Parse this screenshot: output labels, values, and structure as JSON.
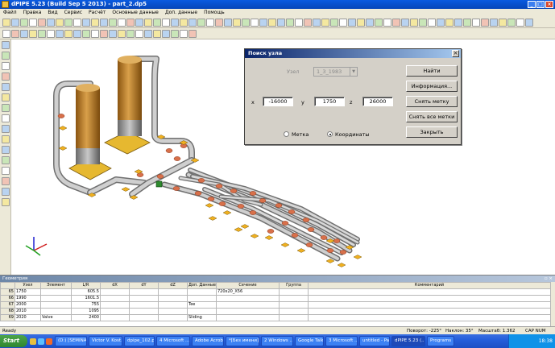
{
  "window": {
    "title": "dPIPE 5.23 (Build Sep 5 2013) - part_2.dp5"
  },
  "menu": [
    "Файл",
    "Правка",
    "Вид",
    "Сервис",
    "Расчёт",
    "Основные данные",
    "Доп. данные",
    "Помощь"
  ],
  "dialog": {
    "title": "Поиск узла",
    "node_label": "Узел",
    "node_value": "1_3_1983",
    "x_label": "x",
    "x_value": "-16000",
    "y_label": "y",
    "y_value": "1750",
    "z_label": "z",
    "z_value": "26000",
    "radio_marker": "Метка",
    "radio_coord": "Координаты",
    "btn_find": "Найти",
    "btn_info": "Информация...",
    "btn_clear": "Снять метку",
    "btn_clear_all": "Снять все метки",
    "btn_close": "Закрыть"
  },
  "geometry": {
    "title": "Геометрия",
    "columns": [
      "",
      "Узел",
      "Элемент",
      "L/R",
      "dX",
      "dY",
      "dZ",
      "Доп. Данные",
      "Сечение",
      "Группа",
      "Комментарий"
    ],
    "rows": [
      [
        "65",
        "1750",
        "",
        "605.5",
        "",
        "",
        "",
        "",
        "720x20_X56",
        "",
        ""
      ],
      [
        "66",
        "1990",
        "",
        "1601.5",
        "",
        "",
        "",
        "",
        "",
        "",
        ""
      ],
      [
        "67",
        "2000",
        "",
        "755",
        "",
        "",
        "",
        "Tee",
        "",
        "",
        ""
      ],
      [
        "68",
        "2010",
        "",
        "1095",
        "",
        "",
        "",
        "",
        "",
        "",
        ""
      ],
      [
        "69",
        "2020",
        "Valve",
        "2400",
        "",
        "",
        "",
        "Sliding",
        "",
        "",
        ""
      ]
    ]
  },
  "status": {
    "ready": "Ready",
    "rotation": "Поворот: -225°",
    "tilt": "Наклон: 35°",
    "scale": "Масштаб: 1.362",
    "keys": "CAP NUM OVR"
  },
  "taskbar": {
    "start": "Start",
    "tasks": [
      "(D:) [SEMINA...",
      "Victor V. Kost...",
      "dpipe_102.ppt",
      "4 Microsoft ...",
      "Adobe Acrob...",
      "*[Без имени]...",
      "2 Windows ...",
      "Google Talk",
      "3 Microsoft ...",
      "untitled - Paint",
      "dPIPE 5.23 (...",
      "Programs"
    ],
    "active_index": 10,
    "clock": "18:38"
  },
  "colors": {
    "pipe": "#b4b4b4",
    "vessel": "#c98a2c",
    "support": "#f0b020",
    "flange": "#d8704a",
    "axis_x": "#d02020",
    "axis_y": "#20a020",
    "axis_z": "#2020d0"
  }
}
